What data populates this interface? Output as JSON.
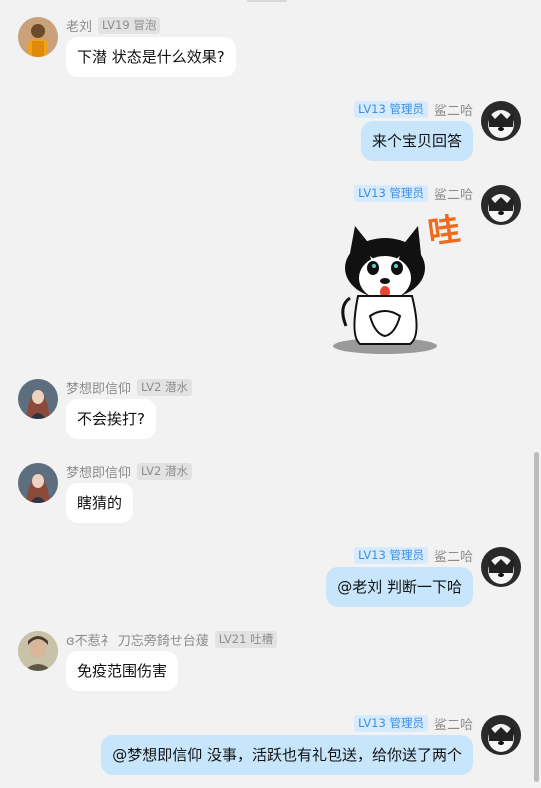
{
  "messages": [
    {
      "nick": "老刘",
      "level": "LV19",
      "role": "冒泡",
      "text": "下潜 状态是什么效果?"
    },
    {
      "nick": "鲨二哈",
      "level": "LV13",
      "role": "管理员",
      "text": "来个宝贝回答"
    },
    {
      "nick": "鲨二哈",
      "level": "LV13",
      "role": "管理员",
      "sticker_text": "哇"
    },
    {
      "nick": "梦想即信仰",
      "level": "LV2",
      "role": "潜水",
      "text": "不会挨打?"
    },
    {
      "nick": "梦想即信仰",
      "level": "LV2",
      "role": "潜水",
      "text": "瞎猜的"
    },
    {
      "nick": "鲨二哈",
      "level": "LV13",
      "role": "管理员",
      "text": "@老刘 判断一下哈"
    },
    {
      "nick": "ɞ不惹礻 刀忘旁錡せ台蕿",
      "level": "LV21",
      "role": "吐槽",
      "text": "免疫范围伤害"
    },
    {
      "nick": "鲨二哈",
      "level": "LV13",
      "role": "管理员",
      "text": "@梦想即信仰 没事，活跃也有礼包送，给你送了两个"
    }
  ],
  "colors": {
    "bubble_self": "#c7e5fb",
    "bubble_other": "#ffffff",
    "admin_tag": "#3b8fe0"
  }
}
